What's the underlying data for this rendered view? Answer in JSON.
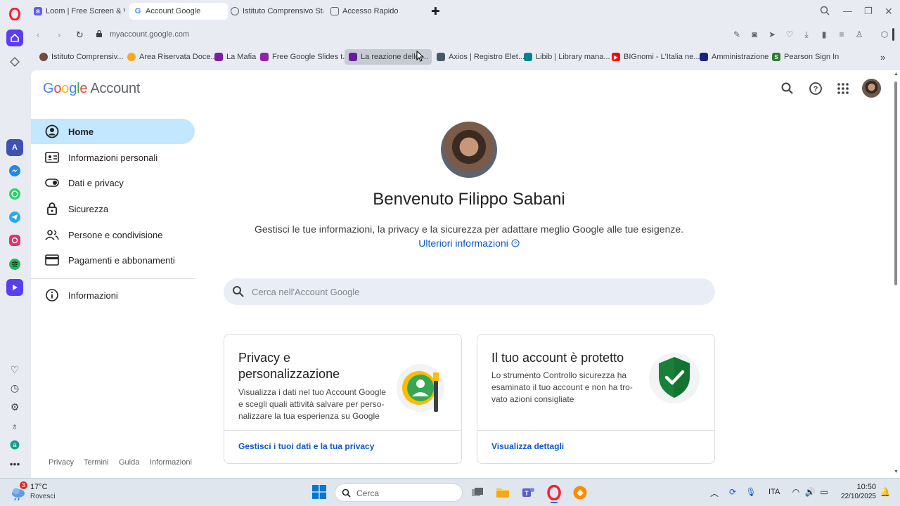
{
  "tabs": [
    {
      "label": "Loom | Free Screen & Vid",
      "fav_color": "#625df5"
    },
    {
      "label": "Account Google",
      "fav_color": "#ffffff",
      "active": true
    },
    {
      "label": "Istituto Comprensivo Stata",
      "fav_color": "#5f6368"
    },
    {
      "label": "Accesso Rapido",
      "fav_color": "#5f6368"
    }
  ],
  "address": {
    "url": "myaccount.google.com"
  },
  "bookmarks": [
    {
      "label": "Istituto Comprensiv...",
      "color": "#6d4c41"
    },
    {
      "label": "Area Riservata Doce...",
      "color": "#f9a825"
    },
    {
      "label": "La Mafia",
      "color": "#7b1fa2"
    },
    {
      "label": "Free Google Slides t...",
      "color": "#8e24aa"
    },
    {
      "label": "La reazione dello ...",
      "color": "#6a1b9a"
    },
    {
      "label": "Axios | Registro Elet...",
      "color": "#455a64"
    },
    {
      "label": "Libib | Library mana...",
      "color": "#00838f"
    },
    {
      "label": "BIGnomi - L'Italia ne...",
      "color": "#ff0000"
    },
    {
      "label": "Amministrazione",
      "color": "#1a237e"
    },
    {
      "label": "Pearson Sign In",
      "color": "#2e7d32"
    }
  ],
  "header": {
    "brand_letters": [
      {
        "c": "G",
        "color": "#4285f4"
      },
      {
        "c": "o",
        "color": "#ea4335"
      },
      {
        "c": "o",
        "color": "#fbbc05"
      },
      {
        "c": "g",
        "color": "#4285f4"
      },
      {
        "c": "l",
        "color": "#34a853"
      },
      {
        "c": "e",
        "color": "#ea4335"
      }
    ],
    "brand_suffix": "Account"
  },
  "sidebar": {
    "items": [
      {
        "label": "Home",
        "icon": "account-circle-icon",
        "active": true
      },
      {
        "label": "Informazioni personali",
        "icon": "id-card-icon"
      },
      {
        "label": "Dati e privacy",
        "icon": "toggle-icon"
      },
      {
        "label": "Sicurezza",
        "icon": "lock-icon"
      },
      {
        "label": "Persone e condivisione",
        "icon": "people-icon"
      },
      {
        "label": "Pagamenti e abbonamenti",
        "icon": "credit-card-icon"
      }
    ],
    "about": {
      "label": "Informazioni",
      "icon": "info-icon"
    },
    "footer": [
      "Privacy",
      "Termini",
      "Guida",
      "Informazioni"
    ]
  },
  "main": {
    "welcome": "Benvenuto Filippo Sabani",
    "subtitle": "Gestisci le tue informazioni, la privacy e la sicurezza per adattare meglio Google alle tue esigenze.",
    "more_link": "Ulteriori informazioni",
    "search_placeholder": "Cerca nell'Account Google",
    "cards": [
      {
        "title_lines": [
          "Privacy e",
          "personalizzazione"
        ],
        "desc_lines": [
          "Visualizza i dati nel tuo Account Google",
          "e scegli quali attività salvare per perso-",
          "nalizzare la tua esperienza su Google"
        ],
        "link": "Gestisci i tuoi dati e la tua privacy"
      },
      {
        "title_lines": [
          "Il tuo account è protetto"
        ],
        "desc_lines": [
          "Lo strumento Controllo sicurezza ha",
          "esaminato il tuo account e non ha tro-",
          "vato azioni consigliate"
        ],
        "link": "Visualizza dettagli"
      }
    ]
  },
  "taskbar": {
    "weather_temp": "17°C",
    "weather_desc": "Rovesci",
    "weather_badge": "3",
    "search_label": "Cerca",
    "lang": "ITA",
    "time": "10:50",
    "date": "22/10/2025"
  }
}
